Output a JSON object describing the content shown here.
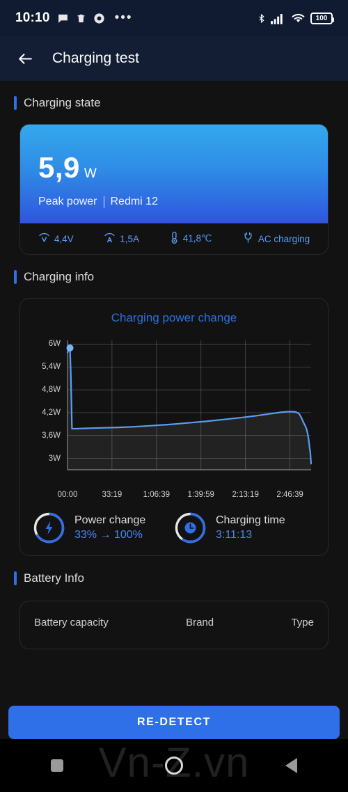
{
  "statusbar": {
    "time": "10:10",
    "left_icons": [
      "chat-bubble-icon",
      "trash-icon",
      "browser-icon",
      "overflow-dots-icon"
    ],
    "right_icons": [
      "bluetooth-icon",
      "signal-bars-icon",
      "wifi-icon"
    ],
    "battery_level": "100"
  },
  "appbar": {
    "back_icon": "back-arrow-icon",
    "title": "Charging test"
  },
  "sections": {
    "charging_state": "Charging state",
    "charging_info": "Charging info",
    "battery_info": "Battery Info"
  },
  "hero": {
    "value": "5,9",
    "unit": "W",
    "caption_left": "Peak power",
    "caption_right": "Redmi 12",
    "stats": [
      {
        "icon": "voltage-icon",
        "value": "4,4V"
      },
      {
        "icon": "current-icon",
        "value": "1,5A"
      },
      {
        "icon": "thermometer-icon",
        "value": "41,8℃"
      },
      {
        "icon": "plug-icon",
        "value": "AC charging"
      }
    ]
  },
  "metrics": [
    {
      "icon": "lightning-bolt-icon",
      "label": "Power change",
      "value": "33% → 100%",
      "progress": 67
    },
    {
      "icon": "clock-icon",
      "label": "Charging time",
      "value": "3:11:13",
      "progress": 60
    }
  ],
  "battery_info_rows": [
    {
      "label": "Battery capacity",
      "value": "Brand",
      "extra": "Type"
    }
  ],
  "bottom": {
    "redetect_label": "RE-DETECT"
  },
  "navbar": {
    "recents_icon": "square-icon",
    "home_icon": "circle-icon",
    "back_icon": "triangle-back-icon"
  },
  "watermark": "Vn-Z.vn",
  "colors": {
    "accent": "#2f6fe8",
    "chart_line": "#5b9df5",
    "hero_top": "#34a9ec",
    "hero_bottom": "#2f55dd",
    "background": "#121212",
    "appbar": "#131d33"
  },
  "chart_data": {
    "type": "area",
    "title": "Charging power change",
    "xlabel": "",
    "ylabel": "",
    "grid": true,
    "legend": "none",
    "ylim": [
      2.7,
      6.1
    ],
    "yticks": [
      6,
      5.4,
      4.8,
      4.2,
      3.6,
      3
    ],
    "ytick_labels": [
      "6W",
      "5,4W",
      "4,8W",
      "4,2W",
      "3,6W",
      "3W"
    ],
    "xticks": [
      0,
      1999,
      3999,
      5999,
      7999,
      9999
    ],
    "xtick_labels": [
      "00:00",
      "33:19",
      "1:06:39",
      "1:39:59",
      "2:13:19",
      "2:46:39"
    ],
    "marker_point": {
      "x": 110,
      "y": 5.9
    },
    "series": [
      {
        "name": "Charging power",
        "x": [
          0,
          60,
          110,
          150,
          200,
          400,
          900,
          1500,
          2200,
          3000,
          3800,
          4600,
          5400,
          6200,
          7000,
          7800,
          8500,
          9100,
          9600,
          10000,
          10250,
          10400,
          10520,
          10600,
          10680,
          10740,
          10790,
          10830,
          10860,
          10890,
          10910,
          10930,
          10950
        ],
        "y": [
          5.78,
          5.85,
          5.9,
          5.2,
          3.78,
          3.78,
          3.79,
          3.8,
          3.81,
          3.83,
          3.86,
          3.89,
          3.93,
          3.97,
          4.02,
          4.07,
          4.12,
          4.17,
          4.21,
          4.23,
          4.22,
          4.18,
          4.06,
          3.95,
          3.86,
          3.78,
          3.66,
          3.53,
          3.4,
          3.24,
          3.18,
          3.02,
          2.86
        ]
      }
    ]
  }
}
